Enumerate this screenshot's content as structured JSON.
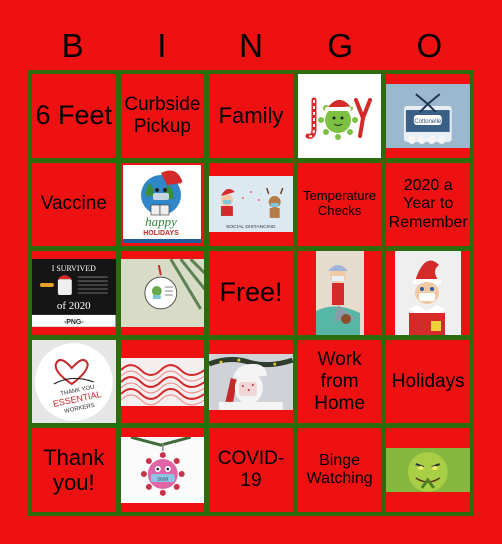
{
  "header": {
    "letters": [
      "B",
      "I",
      "N",
      "G",
      "O"
    ]
  },
  "colors": {
    "background": "#ee1111",
    "grid_border": "#2e6b0c",
    "text": "#000000"
  },
  "cells": [
    {
      "type": "text",
      "text": "6 Feet"
    },
    {
      "type": "text",
      "text": "Curbside Pickup"
    },
    {
      "type": "text",
      "text": "Family"
    },
    {
      "type": "image",
      "image": "joy-virus-santa-hat-icon",
      "caption": "JOY"
    },
    {
      "type": "image",
      "image": "toilet-paper-gift-icon",
      "caption": "Cottonelle"
    },
    {
      "type": "text",
      "text": "Vaccine"
    },
    {
      "type": "image",
      "image": "happy-holidays-earth-mask-icon",
      "caption": "happy HOLIDAYS"
    },
    {
      "type": "image",
      "image": "santa-social-distancing-icon",
      "caption": "SOCIAL DISTANCING"
    },
    {
      "type": "text",
      "text": "Temperature Checks"
    },
    {
      "type": "text",
      "text": "2020 a Year to Remember"
    },
    {
      "type": "image",
      "image": "i-survived-2020-icon",
      "caption": "I SURVIVED of 2020",
      "subcaption": "-PNG-"
    },
    {
      "type": "image",
      "image": "grinch-ornament-icon",
      "caption": ""
    },
    {
      "type": "text",
      "text": "Free!"
    },
    {
      "type": "image",
      "image": "elf-on-shelf-mask-icon",
      "caption": ""
    },
    {
      "type": "image",
      "image": "elf-mask-portrait-icon",
      "caption": ""
    },
    {
      "type": "image",
      "image": "thank-you-essential-workers-icon",
      "caption": "THANK YOU ESSENTIAL WORKERS"
    },
    {
      "type": "image",
      "image": "candy-canes-icon",
      "caption": ""
    },
    {
      "type": "image",
      "image": "santa-mask-icon",
      "caption": ""
    },
    {
      "type": "text",
      "text": "Work from Home"
    },
    {
      "type": "text",
      "text": "Holidays"
    },
    {
      "type": "text",
      "text": "Thank you!"
    },
    {
      "type": "image",
      "image": "covid-ornament-icon",
      "caption": "2020"
    },
    {
      "type": "text",
      "text": "COVID-19"
    },
    {
      "type": "text",
      "text": "Binge Watching"
    },
    {
      "type": "image",
      "image": "grinch-face-icon",
      "caption": ""
    }
  ]
}
